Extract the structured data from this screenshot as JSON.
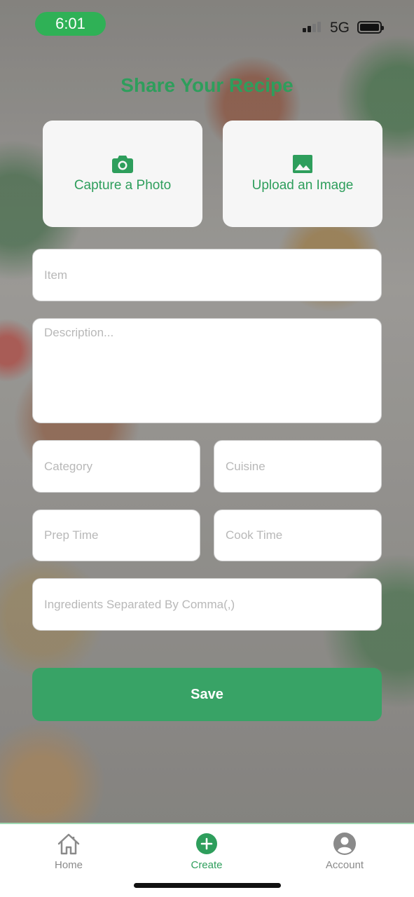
{
  "status_bar": {
    "time": "6:01",
    "network": "5G"
  },
  "page": {
    "title": "Share Your Recipe"
  },
  "media": {
    "capture_label": "Capture a Photo",
    "upload_label": "Upload an Image"
  },
  "form": {
    "item_placeholder": "Item",
    "description_placeholder": "Description...",
    "category_placeholder": "Category",
    "cuisine_placeholder": "Cuisine",
    "prep_time_placeholder": "Prep Time",
    "cook_time_placeholder": "Cook Time",
    "ingredients_placeholder": "Ingredients Separated By Comma(,)",
    "save_label": "Save"
  },
  "tabs": [
    {
      "label": "Home",
      "icon": "home-icon",
      "active": false
    },
    {
      "label": "Create",
      "icon": "plus-circle-icon",
      "active": true
    },
    {
      "label": "Account",
      "icon": "account-icon",
      "active": false
    }
  ],
  "colors": {
    "accent": "#2e9e5c",
    "button": "#38a366",
    "status_pill": "#2fb156"
  }
}
